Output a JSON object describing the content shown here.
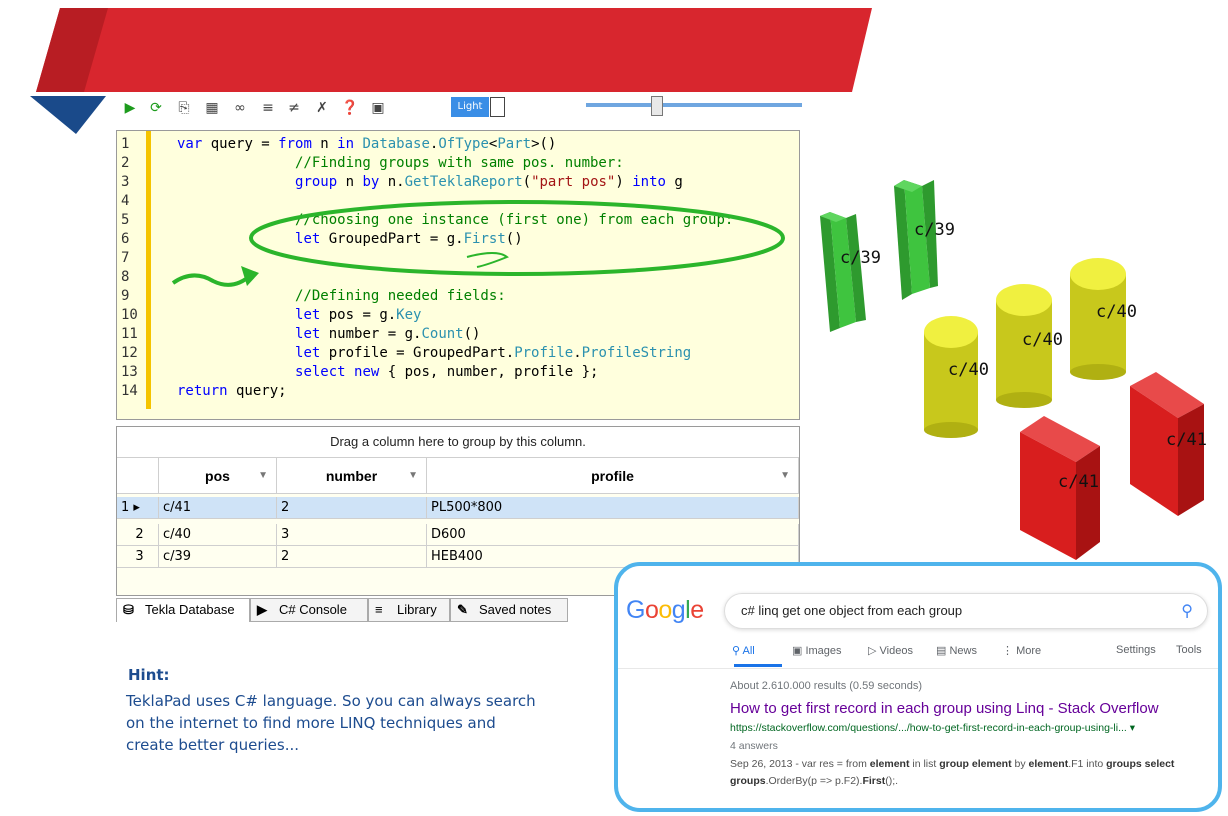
{
  "toolbar": {
    "icons": [
      "run-icon",
      "refresh-icon",
      "export-icon",
      "table-icon",
      "search-replace-icon",
      "comment-icon",
      "uncomment-icon",
      "clear-icon",
      "help-icon",
      "snippet-icon"
    ],
    "light_label": "Light",
    "zoom_level": 0.32
  },
  "editor": {
    "line_numbers": [
      "1",
      "2",
      "3",
      "4",
      "5",
      "6",
      "7",
      "8",
      "9",
      "10",
      "11",
      "12",
      "13",
      "14"
    ]
  },
  "grid": {
    "group_hint": "Drag a column here to group by this column.",
    "columns": [
      "pos",
      "number",
      "profile"
    ],
    "rows": [
      {
        "index": "1",
        "pos": "c/41",
        "number": "2",
        "profile": "PL500*800"
      },
      {
        "index": "2",
        "pos": "c/40",
        "number": "3",
        "profile": "D600"
      },
      {
        "index": "3",
        "pos": "c/39",
        "number": "2",
        "profile": "HEB400"
      }
    ]
  },
  "tabs": [
    "Tekla Database",
    "C# Console",
    "Library",
    "Saved notes"
  ],
  "hint": {
    "title": "Hint:",
    "text": "TeklaPad uses C# language. So you can always search on the internet to find more LINQ techniques and create better queries..."
  },
  "model_labels": {
    "beam_left": "c/39",
    "beam_right": "c/39",
    "cyl_front": "c/40",
    "cyl_mid": "c/40",
    "cyl_back": "c/40",
    "box_front": "c/41",
    "box_back": "c/41"
  },
  "google": {
    "query": "c# linq get one object from each group",
    "tabs": {
      "all": "All",
      "images": "Images",
      "videos": "Videos",
      "news": "News",
      "more": "More",
      "settings": "Settings",
      "tools": "Tools"
    },
    "result_count": "About 2.610.000 results (0.59 seconds)",
    "result_title": "How to get first record in each group using Linq - Stack Overflow",
    "result_url": "https://stackoverflow.com/questions/.../how-to-get-first-record-in-each-group-using-li...",
    "result_answers": "4 answers",
    "snippet_date": "Sep 26, 2013 - var res = from ",
    "snippet_rest": "groups.OrderBy(p => p.F2).First();."
  },
  "colors": {
    "banner_red": "#d8262e",
    "banner_blue": "#1a4a8a",
    "editor_bg": "#ffffdd",
    "gutter_yellow": "#f5c400",
    "annotation_green": "#2bb52b",
    "google_border": "#4fb4ec"
  }
}
